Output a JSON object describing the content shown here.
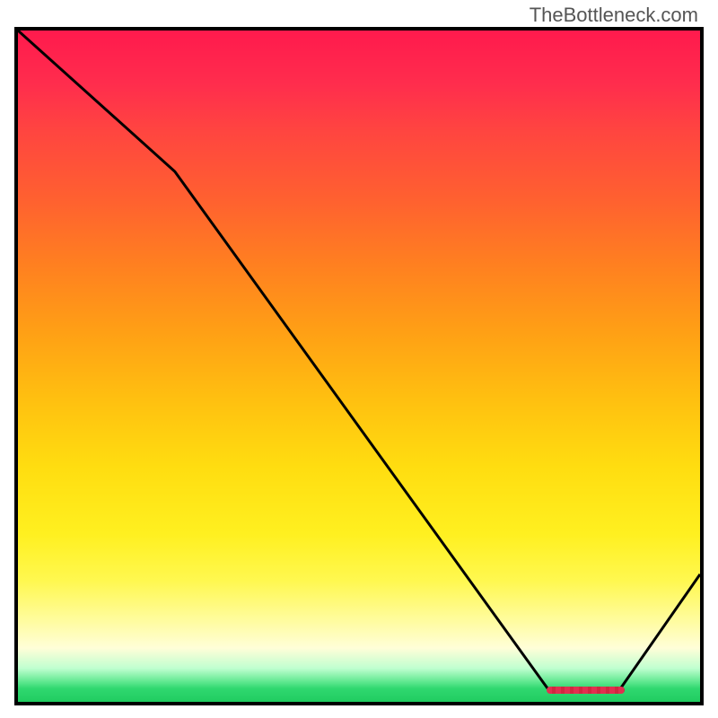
{
  "watermark": "TheBottleneck.com",
  "colors": {
    "border": "#000000",
    "line": "#000000",
    "marker": "#e03050"
  },
  "chart_data": {
    "type": "line",
    "title": "",
    "xlabel": "",
    "ylabel": "",
    "x": [
      0,
      23,
      78,
      88,
      100
    ],
    "values": [
      100,
      79,
      1.5,
      1.5,
      19
    ],
    "xlim": [
      0,
      100
    ],
    "ylim": [
      0,
      100
    ],
    "marker_range": [
      77.5,
      89
    ],
    "marker_y": 1.8
  }
}
